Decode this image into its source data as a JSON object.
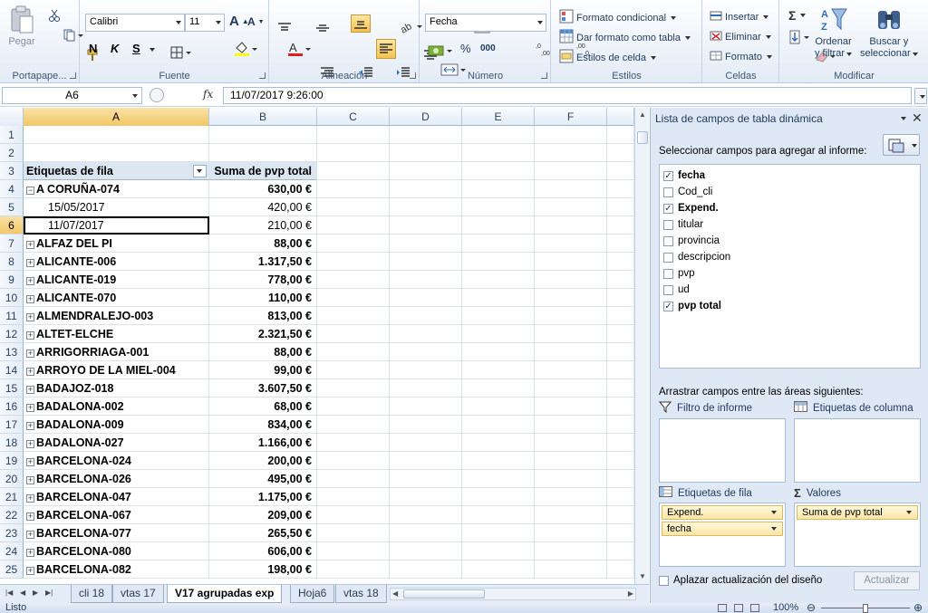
{
  "ribbon": {
    "clipboard": {
      "paste": "Pegar",
      "group": "Portapape..."
    },
    "font": {
      "name": "Calibri",
      "size": "11",
      "bold": "N",
      "italic": "K",
      "underline": "S",
      "group": "Fuente",
      "grow": "A",
      "shrink": "A"
    },
    "alignment": {
      "group": "Alineación"
    },
    "number": {
      "format": "Fecha",
      "percent": "%",
      "thousands": "000",
      "group": "Número"
    },
    "styles": {
      "conditional": "Formato condicional",
      "table": "Dar formato como tabla",
      "cell": "Estilos de celda",
      "group": "Estilos"
    },
    "cells": {
      "insert": "Insertar",
      "delete": "Eliminar",
      "format": "Formato",
      "group": "Celdas"
    },
    "editing": {
      "sum": "Σ",
      "sort1": "Ordenar",
      "sort2": "y filtrar",
      "find1": "Buscar y",
      "find2": "seleccionar",
      "group": "Modificar"
    }
  },
  "formula_bar": {
    "name_box": "A6",
    "fx": "fx",
    "value": "11/07/2017  9:26:00"
  },
  "columns": [
    "A",
    "B",
    "C",
    "D",
    "E",
    "F"
  ],
  "pivot_header": {
    "labels": "Etiquetas de fila",
    "values": "Suma de pvp total"
  },
  "rows": [
    {
      "n": "1",
      "a": "",
      "b": ""
    },
    {
      "n": "2",
      "a": "",
      "b": ""
    },
    {
      "n": "3",
      "a": "Etiquetas de fila",
      "b": "Suma de pvp total",
      "kind": "header"
    },
    {
      "n": "4",
      "a": "A CORUÑA-074",
      "b": "630,00 €",
      "kind": "group",
      "sign": "⊟"
    },
    {
      "n": "5",
      "a": "15/05/2017",
      "b": "420,00 €",
      "kind": "sub"
    },
    {
      "n": "6",
      "a": "11/07/2017",
      "b": "210,00 €",
      "kind": "sub",
      "selected": true
    },
    {
      "n": "7",
      "a": "ALFAZ DEL PI",
      "b": "88,00 €",
      "kind": "group",
      "sign": "⊞"
    },
    {
      "n": "8",
      "a": "ALICANTE-006",
      "b": "1.317,50 €",
      "kind": "group",
      "sign": "⊞"
    },
    {
      "n": "9",
      "a": "ALICANTE-019",
      "b": "778,00 €",
      "kind": "group",
      "sign": "⊞"
    },
    {
      "n": "10",
      "a": "ALICANTE-070",
      "b": "110,00 €",
      "kind": "group",
      "sign": "⊞"
    },
    {
      "n": "11",
      "a": "ALMENDRALEJO-003",
      "b": "813,00 €",
      "kind": "group",
      "sign": "⊞"
    },
    {
      "n": "12",
      "a": "ALTET-ELCHE",
      "b": "2.321,50 €",
      "kind": "group",
      "sign": "⊞"
    },
    {
      "n": "13",
      "a": "ARRIGORRIAGA-001",
      "b": "88,00 €",
      "kind": "group",
      "sign": "⊞"
    },
    {
      "n": "14",
      "a": "ARROYO DE LA MIEL-004",
      "b": "99,00 €",
      "kind": "group",
      "sign": "⊞"
    },
    {
      "n": "15",
      "a": "BADAJOZ-018",
      "b": "3.607,50 €",
      "kind": "group",
      "sign": "⊞"
    },
    {
      "n": "16",
      "a": "BADALONA-002",
      "b": "68,00 €",
      "kind": "group",
      "sign": "⊞"
    },
    {
      "n": "17",
      "a": "BADALONA-009",
      "b": "834,00 €",
      "kind": "group",
      "sign": "⊞"
    },
    {
      "n": "18",
      "a": "BADALONA-027",
      "b": "1.166,00 €",
      "kind": "group",
      "sign": "⊞"
    },
    {
      "n": "19",
      "a": "BARCELONA-024",
      "b": "200,00 €",
      "kind": "group",
      "sign": "⊞"
    },
    {
      "n": "20",
      "a": "BARCELONA-026",
      "b": "495,00 €",
      "kind": "group",
      "sign": "⊞"
    },
    {
      "n": "21",
      "a": "BARCELONA-047",
      "b": "1.175,00 €",
      "kind": "group",
      "sign": "⊞"
    },
    {
      "n": "22",
      "a": "BARCELONA-067",
      "b": "209,00 €",
      "kind": "group",
      "sign": "⊞"
    },
    {
      "n": "23",
      "a": "BARCELONA-077",
      "b": "265,50 €",
      "kind": "group",
      "sign": "⊞"
    },
    {
      "n": "24",
      "a": "BARCELONA-080",
      "b": "606,00 €",
      "kind": "group",
      "sign": "⊞"
    },
    {
      "n": "25",
      "a": "BARCELONA-082",
      "b": "198,00 €",
      "kind": "group",
      "sign": "⊞"
    }
  ],
  "sheet_tabs": [
    "cli 18",
    "vtas 17",
    "V17 agrupadas exp",
    "Hoja6",
    "vtas 18"
  ],
  "active_tab": "V17 agrupadas exp",
  "status": {
    "ready": "Listo",
    "zoom": "100%"
  },
  "pivot_panel": {
    "title": "Lista de campos de tabla dinámica",
    "choose": "Seleccionar campos para agregar al informe:",
    "fields": [
      {
        "name": "fecha",
        "checked": true
      },
      {
        "name": "Cod_cli",
        "checked": false
      },
      {
        "name": "Expend.",
        "checked": true
      },
      {
        "name": "titular",
        "checked": false
      },
      {
        "name": "provincia",
        "checked": false
      },
      {
        "name": "descripcion",
        "checked": false
      },
      {
        "name": "pvp",
        "checked": false
      },
      {
        "name": "ud",
        "checked": false
      },
      {
        "name": "pvp total",
        "checked": true
      }
    ],
    "drag": "Arrastrar campos entre las áreas siguientes:",
    "report_filter": "Filtro de informe",
    "column_labels": "Etiquetas de columna",
    "row_labels": "Etiquetas de fila",
    "values": "Valores",
    "row_items": [
      "Expend.",
      "fecha"
    ],
    "value_items": [
      "Suma de pvp total"
    ],
    "defer": "Aplazar actualización del diseño",
    "update": "Actualizar"
  }
}
